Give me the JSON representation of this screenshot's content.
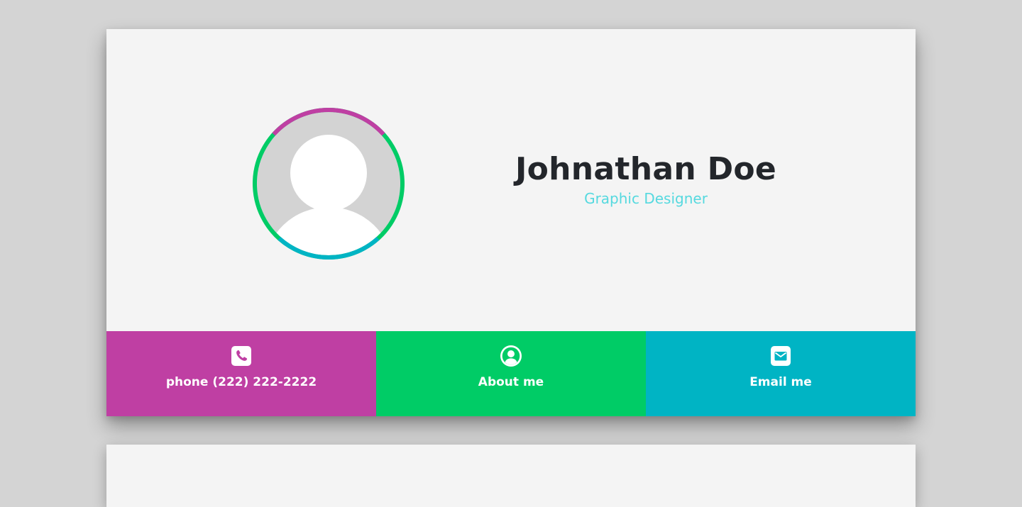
{
  "profile": {
    "name": "Johnathan Doe",
    "role": "Graphic Designer",
    "avatar_icon": "default-user-avatar-icon"
  },
  "colors": {
    "purple": "#bf3fa3",
    "green": "#00cc66",
    "teal": "#00b4c4",
    "role_text": "#55d9df",
    "card_bg": "#f4f4f4",
    "page_bg": "#d4d4d4"
  },
  "actions": [
    {
      "label": "phone (222) 222-2222",
      "icon": "phone-icon",
      "color": "#bf3fa3"
    },
    {
      "label": "About me",
      "icon": "user-circle-icon",
      "color": "#00cc66"
    },
    {
      "label": "Email me",
      "icon": "envelope-icon",
      "color": "#00b4c4"
    }
  ]
}
